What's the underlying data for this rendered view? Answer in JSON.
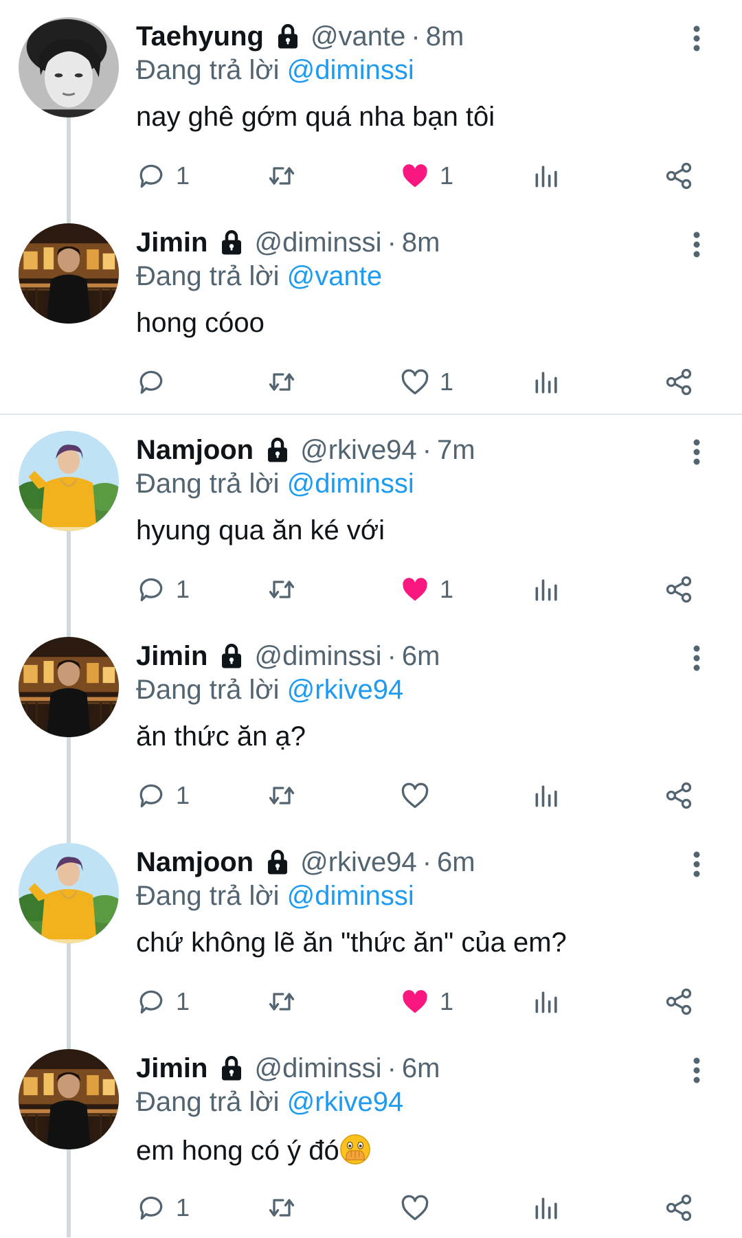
{
  "reply_prefix": "Đang trả lời",
  "colors": {
    "accent": "#1d9bf0",
    "like": "#f91880",
    "muted": "#536471",
    "text": "#0f1419"
  },
  "tweets": [
    {
      "name": "Taehyung",
      "handle": "@vante",
      "sep": "·",
      "time": "8m",
      "reply_to": "@diminssi",
      "text": "nay ghê gớm quá nha bạn tôi",
      "reply_count": "1",
      "retweet_count": "",
      "like_count": "1",
      "liked": true,
      "avatar": "grayscale-portrait"
    },
    {
      "name": "Jimin",
      "handle": "@diminssi",
      "sep": "·",
      "time": "8m",
      "reply_to": "@vante",
      "text": "hong cóoo",
      "reply_count": "",
      "retweet_count": "",
      "like_count": "1",
      "liked": false,
      "avatar": "night-city-portrait"
    },
    {
      "name": "Namjoon",
      "handle": "@rkive94",
      "sep": "·",
      "time": "7m",
      "reply_to": "@diminssi",
      "text": "hyung qua ăn ké với",
      "reply_count": "1",
      "retweet_count": "",
      "like_count": "1",
      "liked": true,
      "avatar": "yellow-sweater-portrait"
    },
    {
      "name": "Jimin",
      "handle": "@diminssi",
      "sep": "·",
      "time": "6m",
      "reply_to": "@rkive94",
      "text": "ăn thức ăn ạ?",
      "reply_count": "1",
      "retweet_count": "",
      "like_count": "",
      "liked": false,
      "avatar": "night-city-portrait"
    },
    {
      "name": "Namjoon",
      "handle": "@rkive94",
      "sep": "·",
      "time": "6m",
      "reply_to": "@diminssi",
      "text": "chứ không lẽ ăn \"thức ăn\" của em?",
      "reply_count": "1",
      "retweet_count": "",
      "like_count": "1",
      "liked": true,
      "avatar": "yellow-sweater-portrait"
    },
    {
      "name": "Jimin",
      "handle": "@diminssi",
      "sep": "·",
      "time": "6m",
      "reply_to": "@rkive94",
      "text": "em hong có ý đó",
      "text_emoji": "face-with-open-eyes-and-hand-over-mouth-emoji",
      "reply_count": "1",
      "retweet_count": "",
      "like_count": "",
      "liked": false,
      "avatar": "night-city-portrait"
    }
  ]
}
